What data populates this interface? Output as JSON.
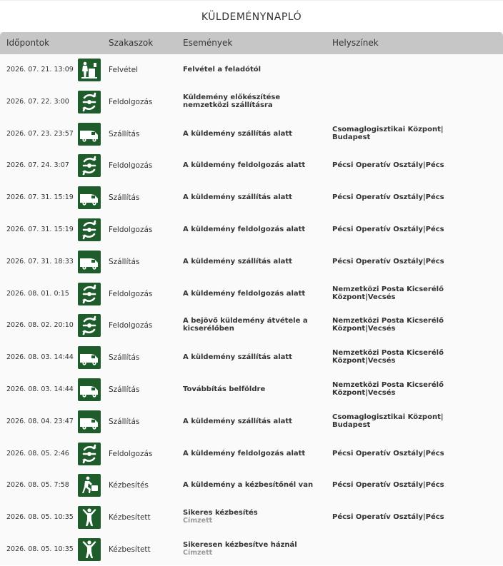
{
  "page": {
    "title": "KÜLDEMÉNYNAPLÓ"
  },
  "table": {
    "headers": {
      "time": "Időpontok",
      "stage": "Szakaszok",
      "event": "Események",
      "location": "Helyszínek"
    },
    "rows": [
      {
        "time": "2026. 07. 21. 13:09",
        "icon": "pickup-icon",
        "stage": "Felvétel",
        "event": "Felvétel a feladótól",
        "event_sub": "",
        "location": ""
      },
      {
        "time": "2026. 07. 22. 3:00",
        "icon": "processing-icon",
        "stage": "Feldolgozás",
        "event": "Küldemény előkészítése nemzetközi szállításra",
        "event_sub": "",
        "location": ""
      },
      {
        "time": "2026. 07. 23. 23:57",
        "icon": "van-icon",
        "stage": "Szállítás",
        "event": "A küldemény szállítás alatt",
        "event_sub": "",
        "location": "Csomaglogisztikai Központ| Budapest"
      },
      {
        "time": "2026. 07. 24. 3:07",
        "icon": "processing-icon",
        "stage": "Feldolgozás",
        "event": "A küldemény feldolgozás alatt",
        "event_sub": "",
        "location": "Pécsi Operatív Osztály|Pécs"
      },
      {
        "time": "2026. 07. 31. 15:19",
        "icon": "van-icon",
        "stage": "Szállítás",
        "event": "A küldemény szállítás alatt",
        "event_sub": "",
        "location": "Pécsi Operatív Osztály|Pécs"
      },
      {
        "time": "2026. 07. 31. 15:19",
        "icon": "processing-icon",
        "stage": "Feldolgozás",
        "event": "A küldemény feldolgozás alatt",
        "event_sub": "",
        "location": "Pécsi Operatív Osztály|Pécs"
      },
      {
        "time": "2026. 07. 31. 18:33",
        "icon": "van-icon",
        "stage": "Szállítás",
        "event": "A küldemény szállítás alatt",
        "event_sub": "",
        "location": "Pécsi Operatív Osztály|Pécs"
      },
      {
        "time": "2026. 08. 01. 0:15",
        "icon": "processing-icon",
        "stage": "Feldolgozás",
        "event": "A küldemény feldolgozás alatt",
        "event_sub": "",
        "location": "Nemzetközi Posta Kicserélő Központ|Vecsés"
      },
      {
        "time": "2026. 08. 02. 20:10",
        "icon": "processing-icon",
        "stage": "Feldolgozás",
        "event": "A bejövő küldemény átvétele a kicserélőben",
        "event_sub": "",
        "location": "Nemzetközi Posta Kicserélő Központ|Vecsés"
      },
      {
        "time": "2026. 08. 03. 14:44",
        "icon": "van-icon",
        "stage": "Szállítás",
        "event": "A küldemény szállítás alatt",
        "event_sub": "",
        "location": "Nemzetközi Posta Kicserélő Központ|Vecsés"
      },
      {
        "time": "2026. 08. 03. 14:44",
        "icon": "van-icon",
        "stage": "Szállítás",
        "event": "Továbbítás belföldre",
        "event_sub": "",
        "location": "Nemzetközi Posta Kicserélő Központ|Vecsés"
      },
      {
        "time": "2026. 08. 04. 23:47",
        "icon": "van-icon",
        "stage": "Szállítás",
        "event": "A küldemény szállítás alatt",
        "event_sub": "",
        "location": "Csomaglogisztikai Központ| Budapest"
      },
      {
        "time": "2026. 08. 05. 2:46",
        "icon": "processing-icon",
        "stage": "Feldolgozás",
        "event": "A küldemény feldolgozás alatt",
        "event_sub": "",
        "location": "Pécsi Operatív Osztály|Pécs"
      },
      {
        "time": "2026. 08. 05. 7:58",
        "icon": "courier-icon",
        "stage": "Kézbesítés",
        "event": "A küldemény a kézbesítőnél van",
        "event_sub": "",
        "location": "Pécsi Operatív Osztály|Pécs"
      },
      {
        "time": "2026. 08. 05. 10:35",
        "icon": "delivered-icon",
        "stage": "Kézbesített",
        "event": "Sikeres kézbesítés",
        "event_sub": "Címzett",
        "location": "Pécsi Operatív Osztály|Pécs"
      },
      {
        "time": "2026. 08. 05. 10:35",
        "icon": "delivered-icon",
        "stage": "Kézbesített",
        "event": "Sikeresen kézbesítve háznál",
        "event_sub": "Címzett",
        "location": ""
      }
    ]
  },
  "colors": {
    "icon_bg": "#1e5c2b",
    "header_bg": "#c6c6c6",
    "sub_text": "#999999"
  }
}
